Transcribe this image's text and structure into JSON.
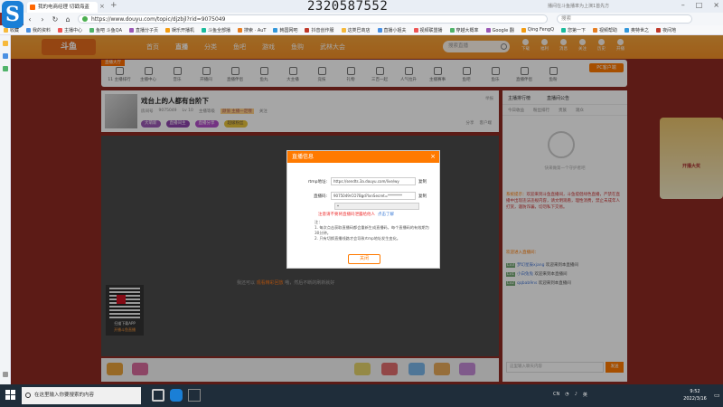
{
  "browser": {
    "tab_title": "我的电商经理 切戳海盗",
    "overlay_number": "2320587552",
    "url": "https://www.douyu.com/topic/djzbjl?rid=9075049",
    "address_search_placeholder": "搜索",
    "window_search_text": "播间在斗鱼播率为上演1首先方",
    "bookmarks": [
      "收藏",
      "我的资料",
      "主播中心",
      "鱼吧 斗鱼QA",
      "直播分子页",
      "娱乐开播机",
      "斗鱼全部播",
      "搜索 · AuT",
      "韩国网吧",
      "抖音创作服",
      "这类巴商店",
      "直播小姐夫",
      "视频联盟播",
      "穿越大概率",
      "Google 翻",
      "Qing FengQ",
      "您第一下",
      "视频帮助",
      "奥特世之",
      "夜间地"
    ],
    "colors": {
      "accent": "#ff7a00",
      "taskbar": "#1f2d3a"
    }
  },
  "site": {
    "logo": "斗鱼",
    "menu": [
      "首页",
      "直播",
      "分类",
      "鱼吧",
      "游戏",
      "鱼购",
      "武林大会"
    ],
    "search_placeholder": "搜索直播",
    "icons": [
      "下载",
      "福利",
      "消息",
      "关注",
      "历史",
      "开播"
    ],
    "category_badge": "直播大厅",
    "categories": [
      "11 主播排行",
      "主播中心",
      "音乐",
      "开播间",
      "直播伴侣",
      "鱼丸",
      "大主播",
      "竞技",
      "礼物",
      "三百一起",
      "人气拉升",
      "主播赛事",
      "鱼吧",
      "鱼乐",
      "直播伴侣",
      "鱼粉"
    ],
    "pc_button": "PC客户端"
  },
  "room": {
    "title": "戏台上的人都有台阶下",
    "meta": [
      "房间号",
      "9075049",
      "Lv 10",
      "主播等级",
      "关注"
    ],
    "meta_tag": "颜值 主播一定哦",
    "tags": [
      "大萌新",
      "直播间主",
      "直播分享",
      "超级粉丝"
    ],
    "report": "举报",
    "actions": [
      "分享",
      "客户端"
    ]
  },
  "video": {
    "message_pre": "我还可以",
    "message_highlight": "观看精彩回放",
    "message_post": "哦，然后不断的刷新就好",
    "qr_label": "扫描下载APP",
    "qr_label2": "开播斗鱼直播"
  },
  "chat": {
    "header": [
      "主播排行榜",
      "直播间公告"
    ],
    "tabs": [
      "今日收益",
      "粉丝排行",
      "贵族",
      "观众"
    ],
    "empty_text": "快来做第一个守护者吧",
    "notice_title": "系统提示：",
    "notice": "欢迎来到斗鱼直播间，斗鱼提倡绿色直播，严禁在直播中出现违法违规内容，请文明观看，理性消费，禁止未成年人打赏，谨防诈骗，切勿私下交易。",
    "welcome_title": "欢迎进入直播间：",
    "lines": [
      {
        "level": "Lv3",
        "name": "梦幻星辰xjang",
        "text": "欢迎来到本直播间"
      },
      {
        "level": "Lv1",
        "name": "小白兔兔",
        "text": "欢迎来到本直播间"
      },
      {
        "level": "Lv2",
        "name": "qqbab9ns",
        "text": "欢迎来到本直播间"
      }
    ],
    "input_placeholder": "这里输入聊天内容",
    "send": "发送"
  },
  "ad": {
    "text": "开播大奖"
  },
  "modal": {
    "title": "直播信息",
    "rtmp_label": "rtmp地址:",
    "rtmp_value": "https://sendts.3a.douyu.com/live/wy",
    "code_label": "直播码:",
    "code_value": "9075049rCO7Bgd?lxnSecret=********",
    "copy": "复制",
    "select_value": "*",
    "warn": "注意请不要将直播码泄露给他人",
    "warn_link": "点击了解",
    "notes": [
      "注：",
      "1. 每次点击获取直播码都会重新生成直播码，每个直播码的有效期为30分钟。",
      "2. 只有切换直播线路才会导致rtmp地址发生变化。"
    ],
    "close_button": "关闭"
  },
  "taskbar": {
    "search_placeholder": "在这里输入你要搜索的内容",
    "tray": [
      "CN",
      "英"
    ],
    "time": "9:52",
    "date": "2022/3/16"
  }
}
